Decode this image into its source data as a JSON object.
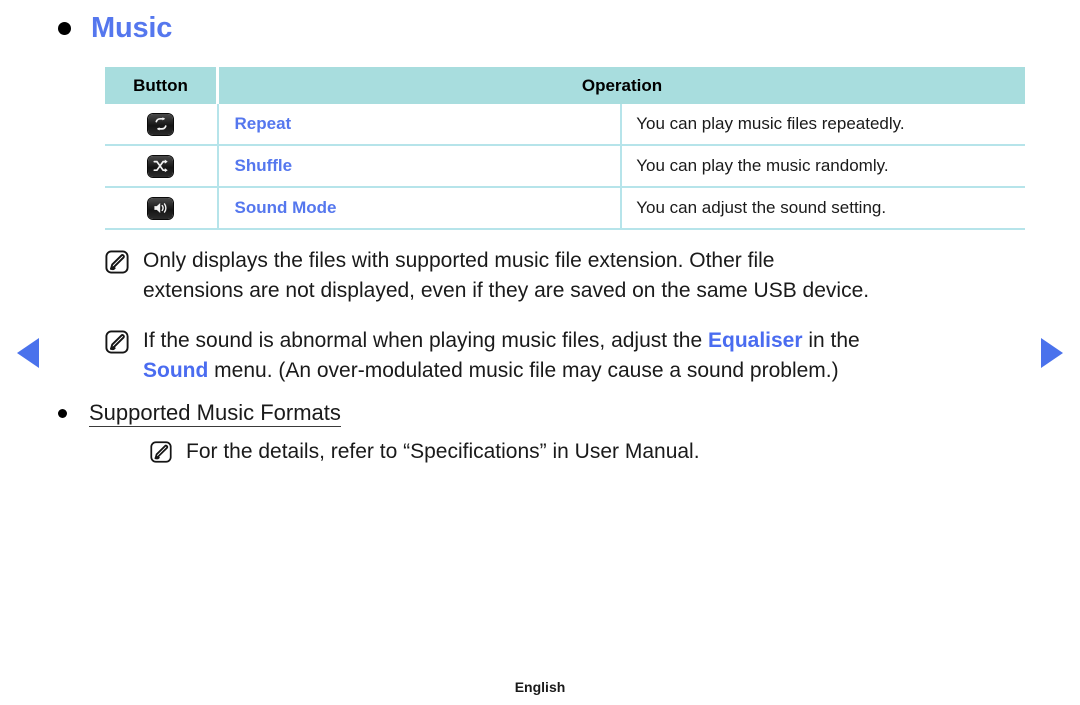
{
  "heading": {
    "bullet_icon": "bullet-dot-icon",
    "title": "Music"
  },
  "table": {
    "columns": [
      "Button",
      "Operation"
    ],
    "rows": [
      {
        "icon": "repeat-icon",
        "label": "Repeat",
        "operation": "You can play music files repeatedly."
      },
      {
        "icon": "shuffle-icon",
        "label": "Shuffle",
        "operation": "You can play the music randomly."
      },
      {
        "icon": "volume-speaker-icon",
        "label": "Sound Mode",
        "operation": "You can adjust the sound setting."
      }
    ]
  },
  "notes": [
    {
      "icon": "note-pencil-icon",
      "line1": "Only displays the files with supported music file extension. Other file",
      "line2": "extensions are not displayed, even if they are saved on the same USB device."
    },
    {
      "icon": "note-pencil-icon",
      "part1": "If the sound is abnormal when playing music files, adjust the ",
      "keyword1": "Equaliser",
      "part2": " in the",
      "keyword2": "Sound",
      "part3": " menu. (An over-modulated music file may cause a sound problem.)"
    },
    {
      "icon": "note-pencil-icon",
      "text": "For the details, refer to “Specifications” in User Manual."
    }
  ],
  "sub_heading": {
    "bullet_icon": "bullet-dot-icon",
    "title": "Supported Music Formats"
  },
  "nav": {
    "prev_icon": "triangle-left-icon",
    "next_icon": "triangle-right-icon"
  },
  "footer": {
    "language": "English"
  },
  "colors": {
    "heading_blue": "#5577ee",
    "keyword_blue": "#4a6cf0",
    "table_header_bg": "#a8ddde",
    "table_border": "#b6e4ea",
    "arrow_blue": "#4a72ec"
  }
}
